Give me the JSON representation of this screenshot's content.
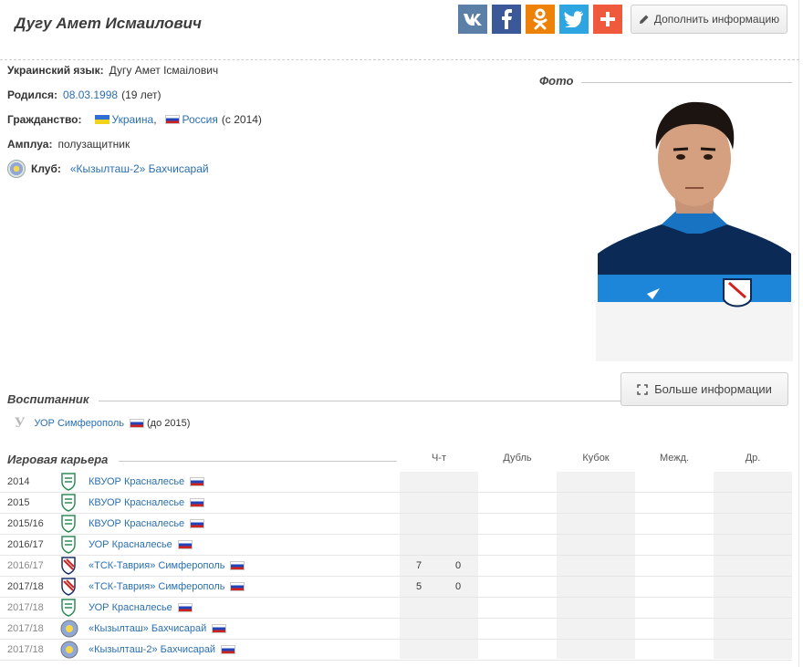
{
  "header": {
    "title": "Дугу Амет Исмаилович",
    "edit_label": "Дополнить информацию",
    "social": [
      {
        "name": "vk",
        "color": "#5b7fa6",
        "glyph": "vk-icon"
      },
      {
        "name": "facebook",
        "color": "#3b5998",
        "glyph": "facebook-icon"
      },
      {
        "name": "odnoklassniki",
        "color": "#ee8208",
        "glyph": "odnoklassniki-icon"
      },
      {
        "name": "twitter",
        "color": "#2ca5e0",
        "glyph": "twitter-icon"
      },
      {
        "name": "share",
        "color": "#ef5a3c",
        "glyph": "plus-icon"
      }
    ]
  },
  "info": {
    "ukr_label": "Украинский язык:",
    "ukr_value": "Дугу Амет Ісмаілович",
    "born_label": "Родился:",
    "born_date": "08.03.1998",
    "born_age": "(19 лет)",
    "citizen_label": "Гражданство:",
    "citizen_1": "Украина",
    "citizen_sep": ",",
    "citizen_2": "Россия",
    "citizen_2_note": "(с 2014)",
    "role_label": "Амплуа:",
    "role_value": "полузащитник",
    "club_label": "Клуб:",
    "club_value": "«Кызылташ-2» Бахчисарай"
  },
  "photo": {
    "title": "Фото",
    "more_label": "Больше информации"
  },
  "academy": {
    "title": "Воспитанник",
    "club": "УОР Симферополь",
    "note": "(до 2015)"
  },
  "career": {
    "title": "Игровая карьера",
    "columns": [
      "Ч-т",
      "Дубль",
      "Кубок",
      "Межд.",
      "Др."
    ],
    "rows": [
      {
        "season": "2014",
        "club": "КВУОР Красналесье",
        "logo": "kvuor",
        "g": "",
        "goals": "",
        "grey": false
      },
      {
        "season": "2015",
        "club": "КВУОР Красналесье",
        "logo": "kvuor",
        "g": "",
        "goals": "",
        "grey": false
      },
      {
        "season": "2015/16",
        "club": "КВУОР Красналесье",
        "logo": "kvuor",
        "g": "",
        "goals": "",
        "grey": false
      },
      {
        "season": "2016/17",
        "club": "УОР Красналесье",
        "logo": "kvuor",
        "g": "",
        "goals": "",
        "grey": false
      },
      {
        "season": "2016/17",
        "club": "«ТСК-Таврия» Симферополь",
        "logo": "tavria",
        "g": "7",
        "goals": "0",
        "grey": true
      },
      {
        "season": "2017/18",
        "club": "«ТСК-Таврия» Симферополь",
        "logo": "tavria",
        "g": "5",
        "goals": "0",
        "grey": false
      },
      {
        "season": "2017/18",
        "club": "УОР Красналесье",
        "logo": "kvuor",
        "g": "",
        "goals": "",
        "grey": true
      },
      {
        "season": "2017/18",
        "club": "«Кызылташ» Бахчисарай",
        "logo": "kyzyl",
        "g": "",
        "goals": "",
        "grey": true
      },
      {
        "season": "2017/18",
        "club": "«Кызылташ-2» Бахчисарай",
        "logo": "kyzyl",
        "g": "",
        "goals": "",
        "grey": true
      }
    ]
  }
}
